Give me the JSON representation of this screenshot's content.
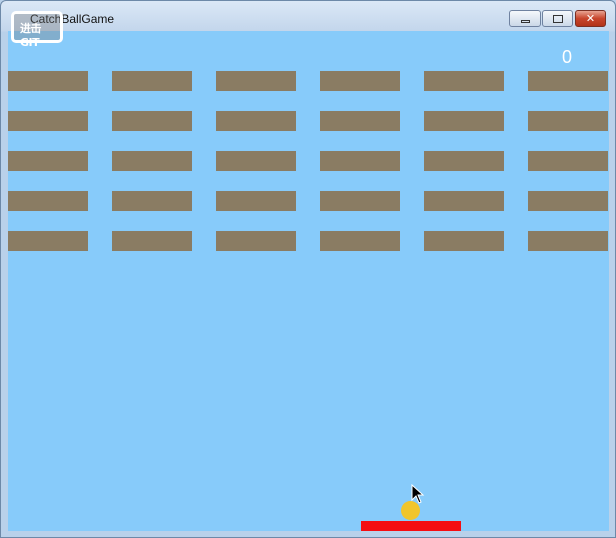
{
  "window": {
    "title": "CatchBallGame",
    "logo_text": "进击GIT",
    "controls": {
      "minimize": "–",
      "maximize": "□",
      "close": "✕"
    }
  },
  "game": {
    "score": "0",
    "brick_rows": 5,
    "brick_cols": 6,
    "colors": {
      "background": "#87cbfa",
      "brick": "#8a7c63",
      "ball": "#f1c52b",
      "paddle": "#f50d12",
      "score": "#ffffff"
    }
  },
  "cursor": {
    "icon": "mouse-pointer-icon"
  }
}
